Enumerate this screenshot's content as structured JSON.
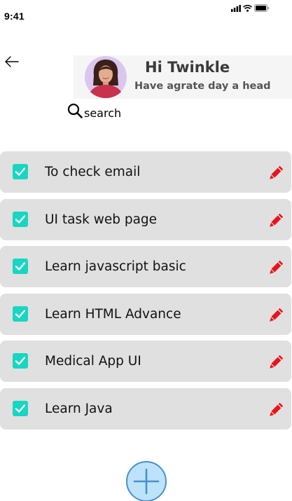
{
  "status_bar": {
    "time": "9:41",
    "icons": [
      "signal-icon",
      "wifi-icon",
      "battery-icon"
    ]
  },
  "header": {
    "back_icon": "arrow-left-icon",
    "greeting_title": "Hi Twinkle",
    "greeting_subtitle": "Have agrate day a head"
  },
  "search": {
    "icon": "search-icon",
    "label": "search"
  },
  "todos": [
    {
      "label": "To check email",
      "checked": true,
      "edit_icon": "pencil-icon"
    },
    {
      "label": "UI task web page",
      "checked": true,
      "edit_icon": "pencil-icon"
    },
    {
      "label": "Learn javascript basic",
      "checked": true,
      "edit_icon": "pencil-icon"
    },
    {
      "label": "Learn HTML Advance",
      "checked": true,
      "edit_icon": "pencil-icon"
    },
    {
      "label": "Medical App UI",
      "checked": true,
      "edit_icon": "pencil-icon"
    },
    {
      "label": "Learn Java",
      "checked": true,
      "edit_icon": "pencil-icon"
    }
  ],
  "add_button": {
    "icon": "plus-icon"
  },
  "colors": {
    "checkbox": "#17d6c2",
    "pencil": "#e8141a",
    "item_bg": "#e0e0e0",
    "add_fill": "#bde3fb",
    "add_border": "#4a90c8"
  }
}
